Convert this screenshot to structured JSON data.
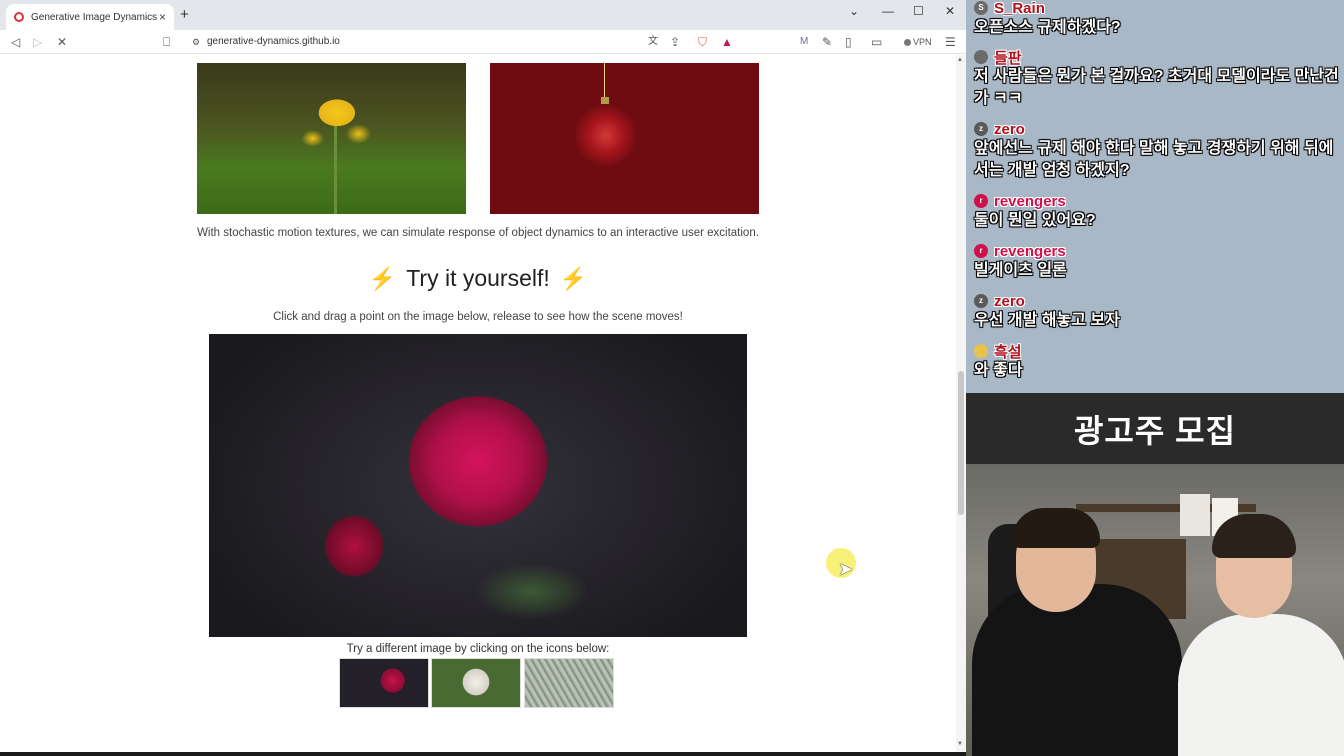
{
  "browser": {
    "tab_title": "Generative Image Dynamics",
    "url": "generative-dynamics.github.io",
    "vpn_label": "VPN"
  },
  "page": {
    "caption_top": "With stochastic motion textures, we can simulate response of object dynamics to an interactive user excitation.",
    "try_title": "Try it yourself!",
    "instructions": "Click and drag a point on the image below, release to see how the scene moves!",
    "caption_bottom": "Try a different image by clicking on the icons below:"
  },
  "chat": {
    "messages": [
      {
        "nick": "S_Rain",
        "avatar_letter": "S",
        "avatar_color": "#6b6b6b",
        "text": "오픈소스 규제하겠다?"
      },
      {
        "nick": "들판",
        "avatar_letter": "",
        "avatar_color": "#6a6a6a",
        "text": "저 사람들은 뭔가 본 걸까요? 초거대 모델이라도 만난건가 ㅋㅋ"
      },
      {
        "nick": "zero",
        "avatar_letter": "z",
        "avatar_color": "#5a5a5a",
        "text": "앞에선느 규제 해야 한다 말해 놓고 경쟁하기 위해 뒤에서는 개발 엄청 하겠지?"
      },
      {
        "nick": "revengers",
        "avatar_letter": "r",
        "avatar_color": "#d0104a",
        "text": "둘이 뭔일 있어요?"
      },
      {
        "nick": "revengers",
        "avatar_letter": "r",
        "avatar_color": "#d0104a",
        "text": "빌게이츠 일론"
      },
      {
        "nick": "zero",
        "avatar_letter": "z",
        "avatar_color": "#5a5a5a",
        "text": "우선 개발 해놓고 보자"
      },
      {
        "nick": "흑설",
        "avatar_letter": "",
        "avatar_color": "#e8c24a",
        "text": "와 좋다"
      }
    ]
  },
  "ad": {
    "text": "광고주 모집"
  }
}
